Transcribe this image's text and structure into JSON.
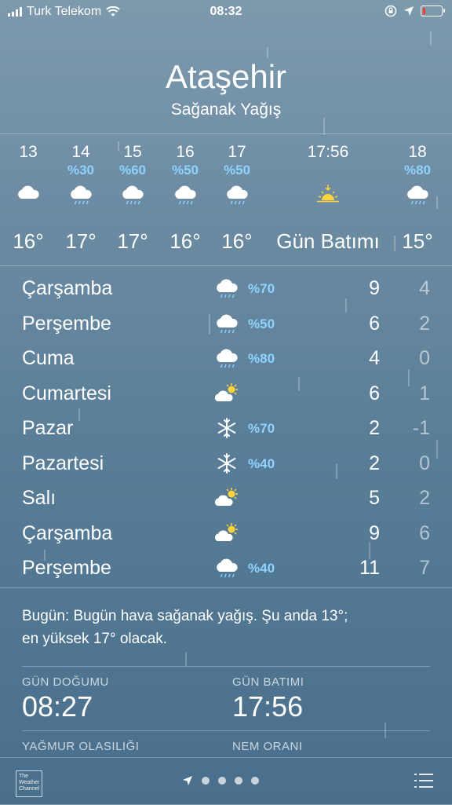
{
  "status_bar": {
    "carrier": "Turk Telekom",
    "time": "08:32"
  },
  "location": {
    "city": "Ataşehir",
    "condition": "Sağanak Yağış"
  },
  "hourly": [
    {
      "label": "13",
      "prob": "",
      "icon": "cloud-icon",
      "temp": "16°"
    },
    {
      "label": "14",
      "prob": "%30",
      "icon": "rain-cloud-icon",
      "temp": "17°"
    },
    {
      "label": "15",
      "prob": "%60",
      "icon": "rain-cloud-icon",
      "temp": "17°"
    },
    {
      "label": "16",
      "prob": "%50",
      "icon": "rain-cloud-icon",
      "temp": "16°"
    },
    {
      "label": "17",
      "prob": "%50",
      "icon": "rain-cloud-icon",
      "temp": "16°"
    },
    {
      "label": "17:56",
      "prob": "",
      "icon": "sunset-icon",
      "temp": "Gün Batımı"
    },
    {
      "label": "18",
      "prob": "%80",
      "icon": "rain-cloud-icon",
      "temp": "15°"
    }
  ],
  "daily": [
    {
      "day": "Çarşamba",
      "icon": "rain-cloud-icon",
      "prob": "%70",
      "high": "9",
      "low": "4"
    },
    {
      "day": "Perşembe",
      "icon": "rain-cloud-icon",
      "prob": "%50",
      "high": "6",
      "low": "2"
    },
    {
      "day": "Cuma",
      "icon": "rain-cloud-icon",
      "prob": "%80",
      "high": "4",
      "low": "0"
    },
    {
      "day": "Cumartesi",
      "icon": "partly-sunny-icon",
      "prob": "",
      "high": "6",
      "low": "1"
    },
    {
      "day": "Pazar",
      "icon": "snowflake-icon",
      "prob": "%70",
      "high": "2",
      "low": "-1"
    },
    {
      "day": "Pazartesi",
      "icon": "snowflake-icon",
      "prob": "%40",
      "high": "2",
      "low": "0"
    },
    {
      "day": "Salı",
      "icon": "partly-sunny-icon",
      "prob": "",
      "high": "5",
      "low": "2"
    },
    {
      "day": "Çarşamba",
      "icon": "partly-sunny-icon",
      "prob": "",
      "high": "9",
      "low": "6"
    },
    {
      "day": "Perşembe",
      "icon": "rain-cloud-icon",
      "prob": "%40",
      "high": "11",
      "low": "7"
    }
  ],
  "summary": {
    "line1": "Bugün: Bugün hava sağanak yağış. Şu anda 13°;",
    "line2": "en yüksek 17° olacak."
  },
  "details": {
    "sunrise_title": "GÜN DOĞUMU",
    "sunrise_value": "08:27",
    "sunset_title": "GÜN BATIMI",
    "sunset_value": "17:56",
    "rain_title": "YAĞMUR OLASILIĞI",
    "humidity_title": "NEM ORANI"
  },
  "bottom_bar": {
    "logo_text": "The Weather Channel",
    "page_count": 4
  },
  "colors": {
    "precip_blue": "#8fd3ff",
    "battery_red": "#ff3b30"
  }
}
